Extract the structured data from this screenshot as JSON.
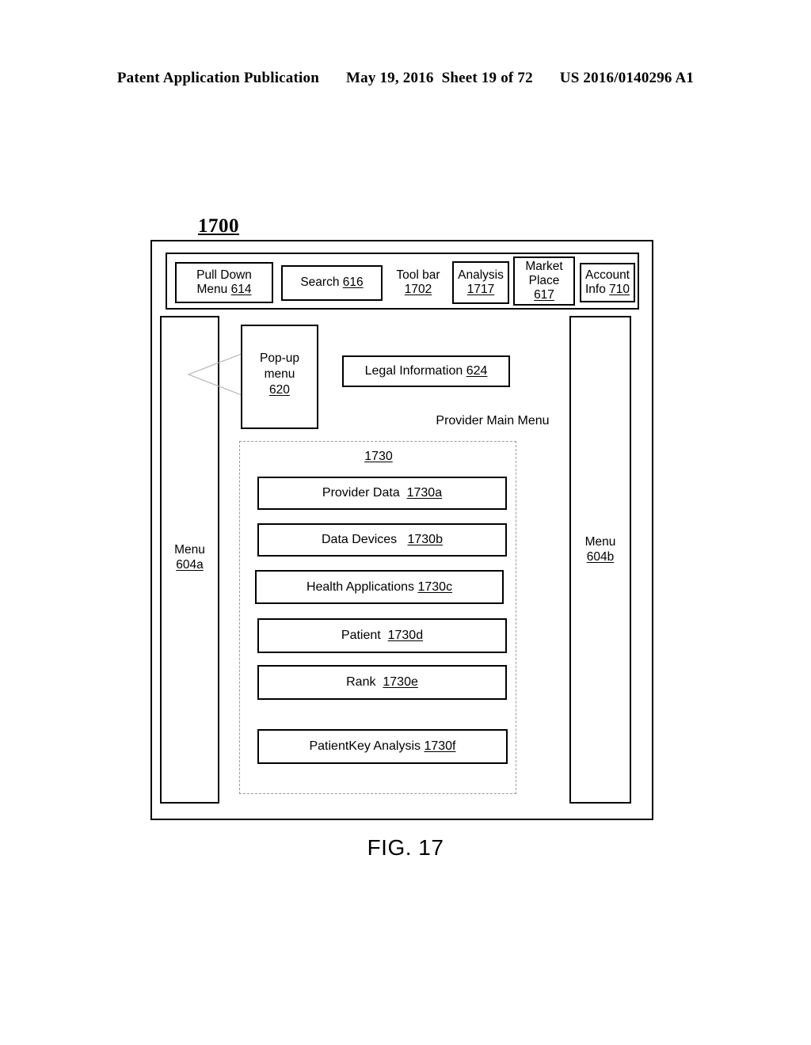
{
  "header": {
    "publication": "Patent Application Publication",
    "date": "May 19, 2016",
    "sheet": "Sheet 19 of 72",
    "patent_number": "US 2016/0140296 A1"
  },
  "figure": {
    "id": "1700",
    "caption": "FIG. 17"
  },
  "toolbar": {
    "items": [
      {
        "label": "Pull Down\nMenu ",
        "ref": "614",
        "boxed": true
      },
      {
        "label": "Search ",
        "ref": "616",
        "boxed": true
      },
      {
        "label": "Tool bar\n",
        "ref": "1702",
        "boxed": false
      },
      {
        "label": "Analysis\n",
        "ref": "1717",
        "boxed": true
      },
      {
        "label": "Market\nPlace\n",
        "ref": "617",
        "boxed": true
      },
      {
        "label": "Account\nInfo ",
        "ref": "710",
        "boxed": true
      }
    ],
    "pulldown_line1": "Pull Down",
    "pulldown_line2": "Menu ",
    "pulldown_ref": "614",
    "search_label": "Search ",
    "search_ref": "616",
    "toolbar_line1": "Tool bar",
    "toolbar_ref": "1702",
    "analysis_line1": "Analysis",
    "analysis_ref": "1717",
    "market_line1": "Market",
    "market_line2": "Place",
    "market_ref": "617",
    "account_line1": "Account",
    "account_line2": "Info ",
    "account_ref": "710"
  },
  "side_menus": {
    "left": {
      "label": "Menu",
      "ref": "604a"
    },
    "right": {
      "label": "Menu",
      "ref": "604b"
    }
  },
  "popup_menu": {
    "line1": "Pop-up",
    "line2": "menu",
    "ref": "620"
  },
  "legal": {
    "label": "Legal Information ",
    "ref": "624"
  },
  "provider_main_menu": {
    "caption": "Provider Main Menu",
    "group_ref": "1730",
    "items": [
      {
        "label": "Provider Data  ",
        "ref": "1730a"
      },
      {
        "label": "Data Devices   ",
        "ref": "1730b"
      },
      {
        "label": "Health Applications ",
        "ref": "1730c"
      },
      {
        "label": "Patient  ",
        "ref": "1730d"
      },
      {
        "label": "Rank  ",
        "ref": "1730e"
      },
      {
        "label": "PatientKey Analysis ",
        "ref": "1730f"
      }
    ]
  },
  "colors": {
    "ink": "#000000",
    "paper": "#ffffff",
    "dashed_border": "#9a9a9a",
    "leader_line": "#b0b0b0"
  }
}
